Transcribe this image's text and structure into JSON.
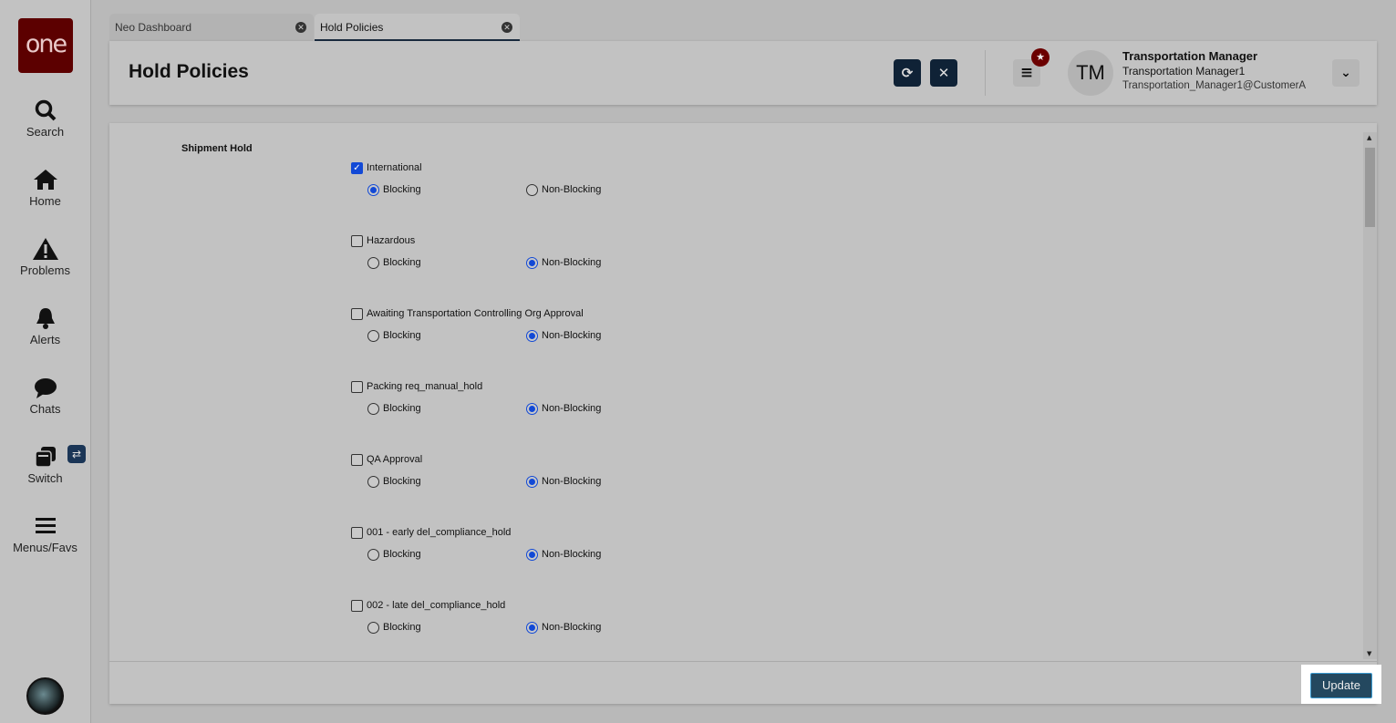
{
  "sidebar": {
    "logo": "one",
    "items": [
      {
        "label": "Search",
        "icon": "search-icon"
      },
      {
        "label": "Home",
        "icon": "home-icon"
      },
      {
        "label": "Problems",
        "icon": "warning-icon"
      },
      {
        "label": "Alerts",
        "icon": "bell-icon"
      },
      {
        "label": "Chats",
        "icon": "chat-icon"
      },
      {
        "label": "Switch",
        "icon": "switch-icon"
      },
      {
        "label": "Menus/Favs",
        "icon": "menu-icon"
      }
    ]
  },
  "tabs": [
    {
      "label": "Neo Dashboard"
    },
    {
      "label": "Hold Policies"
    }
  ],
  "header": {
    "title": "Hold Policies",
    "user_initials": "TM",
    "user_name": "Transportation Manager",
    "user_role": "Transportation Manager1",
    "user_email": "Transportation_Manager1@CustomerA"
  },
  "content": {
    "section": "Shipment Hold",
    "blocking_label": "Blocking",
    "nonblocking_label": "Non-Blocking",
    "items": [
      {
        "label": "International",
        "checked": true,
        "mode": "Blocking"
      },
      {
        "label": "Hazardous",
        "checked": false,
        "mode": "Non-Blocking"
      },
      {
        "label": "Awaiting Transportation Controlling Org Approval",
        "checked": false,
        "mode": "Non-Blocking"
      },
      {
        "label": "Packing req_manual_hold",
        "checked": false,
        "mode": "Non-Blocking"
      },
      {
        "label": "QA Approval",
        "checked": false,
        "mode": "Non-Blocking"
      },
      {
        "label": "001 - early del_compliance_hold",
        "checked": false,
        "mode": "Non-Blocking"
      },
      {
        "label": "002 - late del_compliance_hold",
        "checked": false,
        "mode": "Non-Blocking"
      }
    ]
  },
  "footer": {
    "update_label": "Update"
  }
}
